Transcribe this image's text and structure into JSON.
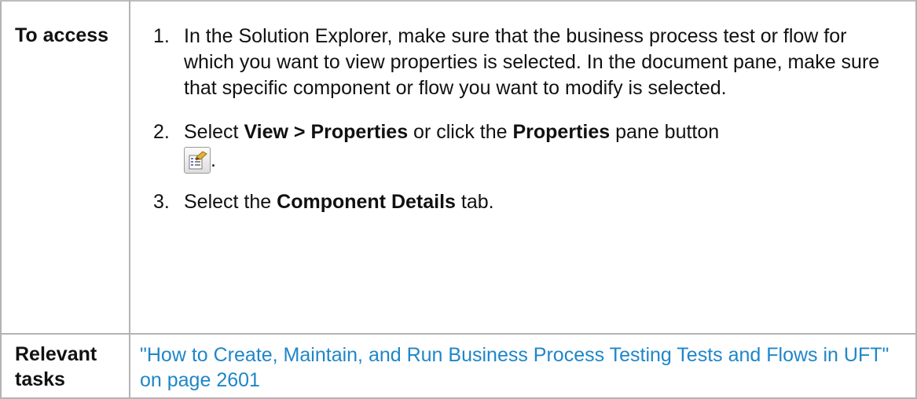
{
  "rows": {
    "access": {
      "heading": "To access",
      "steps": [
        {
          "num": "1.",
          "text": "In the Solution Explorer, make sure that the business process test or flow for which you want to view properties is selected. In the document pane, make sure that specific component or flow you want to modify is selected."
        },
        {
          "num": "2.",
          "prefix": "Select ",
          "bold_1": "View > Properties",
          "middle": " or click the ",
          "bold_2": "Properties",
          "suffix": " pane button",
          "icon": "properties-pane-icon",
          "end": "."
        },
        {
          "num": "3.",
          "prefix": "Select the ",
          "bold": "Component Details",
          "suffix": " tab."
        }
      ]
    },
    "tasks": {
      "heading": "Relevant tasks",
      "link_text": "\"How to Create, Maintain, and Run Business Process Testing Tests and Flows in UFT\" on page 2601"
    }
  },
  "colors": {
    "border": "#b3b3b3",
    "link": "#1f86c8",
    "text": "#111111"
  }
}
